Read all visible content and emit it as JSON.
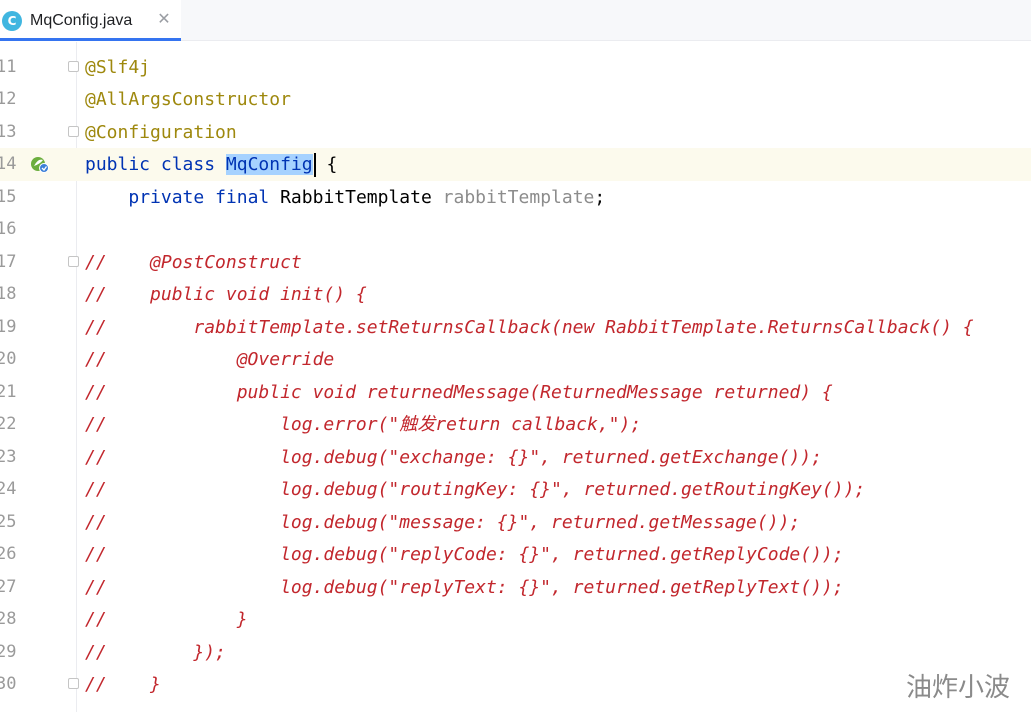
{
  "tab": {
    "icon_letter": "C",
    "title": "MqConfig.java",
    "close_glyph": "✕"
  },
  "editor": {
    "lines": [
      {
        "num": "11",
        "text": "@Slf4j"
      },
      {
        "num": "12",
        "text": "@AllArgsConstructor"
      },
      {
        "num": "13",
        "text": "@Configuration"
      },
      {
        "num": "14",
        "kw1": "public",
        "kw2": "class",
        "name": "MqConfig",
        "rest": "{"
      },
      {
        "num": "15",
        "kw1": "private",
        "kw2": "final",
        "type": "RabbitTemplate",
        "field": "rabbitTemplate",
        "rest": ";"
      },
      {
        "num": "16",
        "text": ""
      },
      {
        "num": "17",
        "text": "//    @PostConstruct"
      },
      {
        "num": "18",
        "text": "//    public void init() {"
      },
      {
        "num": "19",
        "text": "//        rabbitTemplate.setReturnsCallback(new RabbitTemplate.ReturnsCallback() {"
      },
      {
        "num": "20",
        "text": "//            @Override"
      },
      {
        "num": "21",
        "text": "//            public void returnedMessage(ReturnedMessage returned) {"
      },
      {
        "num": "22",
        "text": "//                log.error(\"触发return callback,\");"
      },
      {
        "num": "23",
        "text": "//                log.debug(\"exchange: {}\", returned.getExchange());"
      },
      {
        "num": "24",
        "text": "//                log.debug(\"routingKey: {}\", returned.getRoutingKey());"
      },
      {
        "num": "25",
        "text": "//                log.debug(\"message: {}\", returned.getMessage());"
      },
      {
        "num": "26",
        "text": "//                log.debug(\"replyCode: {}\", returned.getReplyCode());"
      },
      {
        "num": "27",
        "text": "//                log.debug(\"replyText: {}\", returned.getReplyText());"
      },
      {
        "num": "28",
        "text": "//            }"
      },
      {
        "num": "29",
        "text": "//        });"
      },
      {
        "num": "30",
        "text": "//    }"
      }
    ]
  },
  "watermark": "油炸小波",
  "colors": {
    "annotation": "#9e880d",
    "keyword": "#0033b3",
    "comment": "#c2272d",
    "selection": "#a6d2ff",
    "caret_line": "#fcfaed",
    "tab_underline": "#3574f0"
  },
  "icons": {
    "tab": "java-class-icon",
    "gutter": "spring-bean-icon"
  }
}
